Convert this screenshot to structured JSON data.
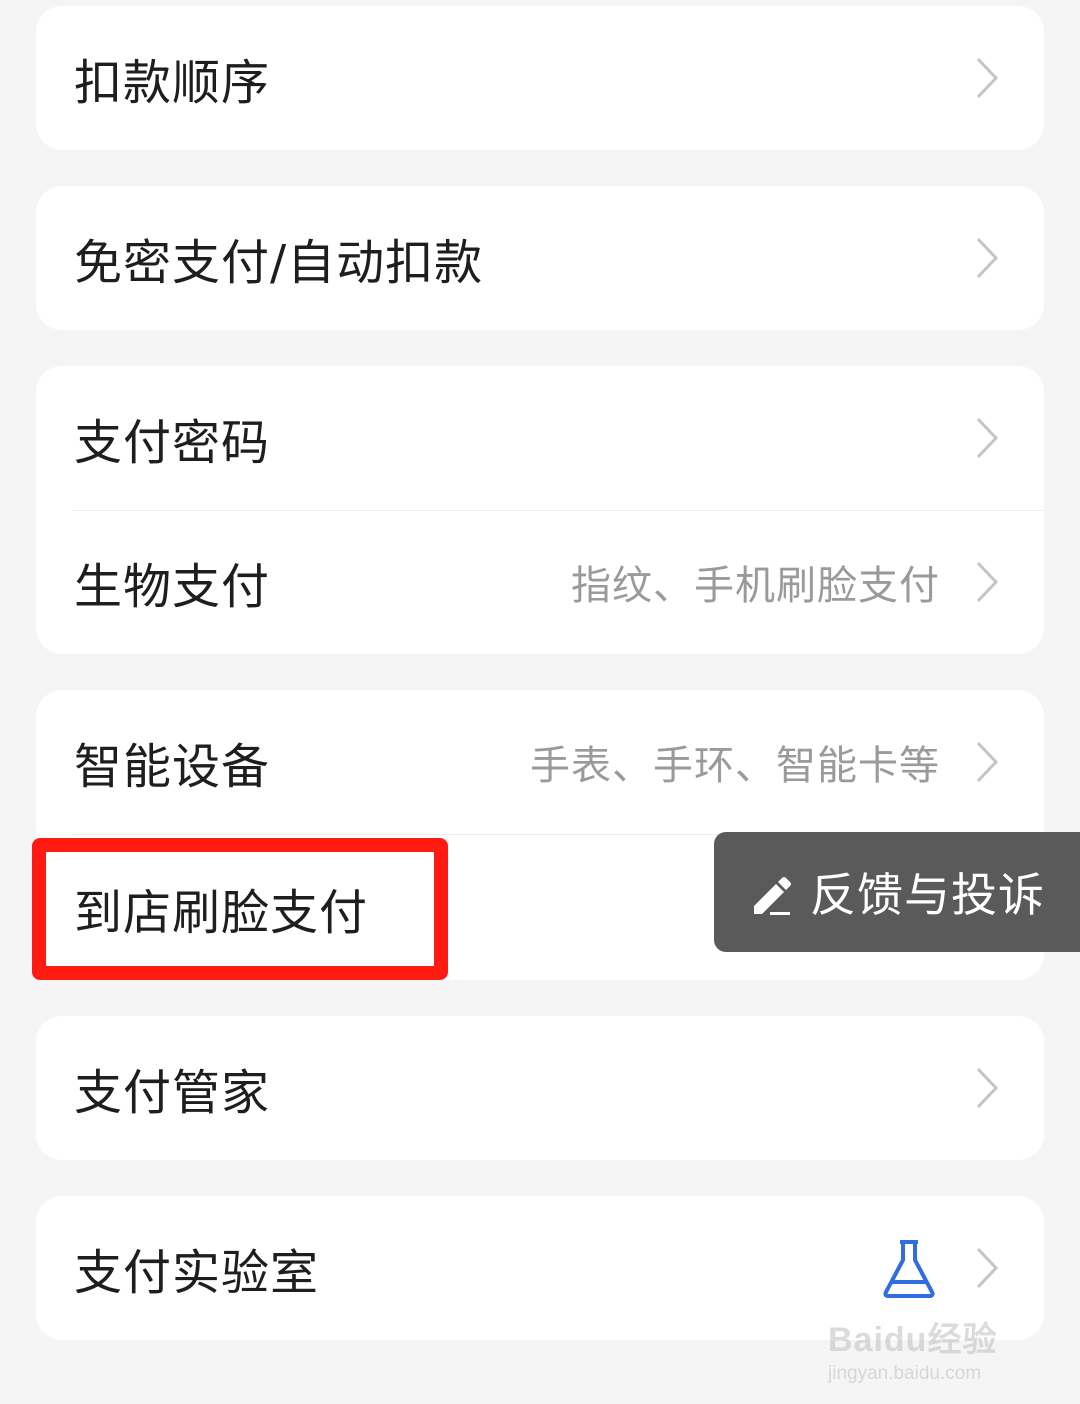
{
  "groups": [
    {
      "rows": [
        {
          "label": "扣款顺序",
          "value": ""
        }
      ]
    },
    {
      "rows": [
        {
          "label": "免密支付/自动扣款",
          "value": ""
        }
      ]
    },
    {
      "rows": [
        {
          "label": "支付密码",
          "value": ""
        },
        {
          "label": "生物支付",
          "value": "指纹、手机刷脸支付"
        }
      ]
    },
    {
      "rows": [
        {
          "label": "智能设备",
          "value": "手表、手环、智能卡等"
        },
        {
          "label": "到店刷脸支付",
          "value": ""
        }
      ]
    },
    {
      "rows": [
        {
          "label": "支付管家",
          "value": ""
        }
      ]
    },
    {
      "rows": [
        {
          "label": "支付实验室",
          "value": "",
          "icon": "flask-icon"
        }
      ]
    }
  ],
  "floating_button": {
    "label": "反馈与投诉",
    "icon": "pen-icon"
  },
  "highlight_target": "到店刷脸支付",
  "watermark": {
    "brand": "Baidu经验",
    "url": "jingyan.baidu.com"
  },
  "colors": {
    "background": "#f5f5f5",
    "card": "#ffffff",
    "highlight_border": "#ff1a12",
    "floating_button_bg": "#5a5a5a",
    "flask_blue": "#2f6de1"
  }
}
